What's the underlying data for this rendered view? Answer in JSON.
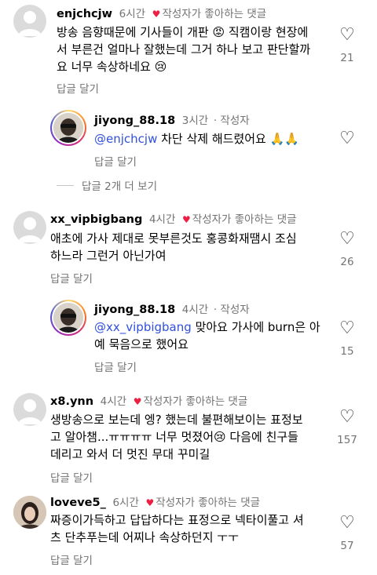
{
  "comments": [
    {
      "username": "enjchcjw",
      "time": "6시간",
      "liked_by_author": "작성자가 좋아하는 댓글",
      "text_lines": [
        "방송 음향때문에 기사들이 개판 😡 직캠이랑 현장에",
        "서 부른건 얼마나 잘했는데 그거 하나 보고 판단할까",
        "요 너무 속상하네요 😢"
      ],
      "reply_label": "답글 달기",
      "likes": "21"
    },
    {
      "username": "jiyong_88.18",
      "time": "3시간",
      "author_badge": "· 작성자",
      "mention": "@enjchcjw",
      "text": "차단 삭제 해드렸어요 🙏🙏",
      "reply_label": "답글 달기"
    },
    {
      "view_more": "답글 2개 더 보기"
    },
    {
      "username": "xx_vipbigbang",
      "time": "4시간",
      "liked_by_author": "작성자가 좋아하는 댓글",
      "text_lines": [
        "애초에 가사 제대로 못부른것도 홍콩화재땜시 조심",
        "하느라 그런거 아닌가여"
      ],
      "reply_label": "답글 달기",
      "likes": "26"
    },
    {
      "username": "jiyong_88.18",
      "time": "4시간",
      "author_badge": "· 작성자",
      "mention": "@xx_vipbigbang",
      "text_line1": "맞아요 가사에 burn은 아",
      "text_line2": "예 묵음으로 했어요",
      "reply_label": "답글 달기",
      "likes": "15"
    },
    {
      "username": "x8.ynn",
      "time": "4시간",
      "liked_by_author": "작성자가 좋아하는 댓글",
      "text_lines": [
        "생방송으로 보는데 엥? 했는데 불편해보이는 표정보",
        "고 알아챔...ㅠㅠㅠㅠ 너무 멋졌어😢 다음에 친구들",
        "데리고 와서 더 멋진 무대 꾸미길"
      ],
      "reply_label": "답글 달기",
      "likes": "157"
    },
    {
      "username": "loveve5_",
      "time": "6시간",
      "liked_by_author": "작성자가 좋아하는 댓글",
      "text_lines": [
        "짜증이가득하고 답답하다는 표정으로 넥타이풀고 셔",
        "츠 단추푸는데 어찌나 속상하던지 ㅜㅜ"
      ],
      "reply_label": "답글 달기",
      "likes": "57"
    }
  ]
}
